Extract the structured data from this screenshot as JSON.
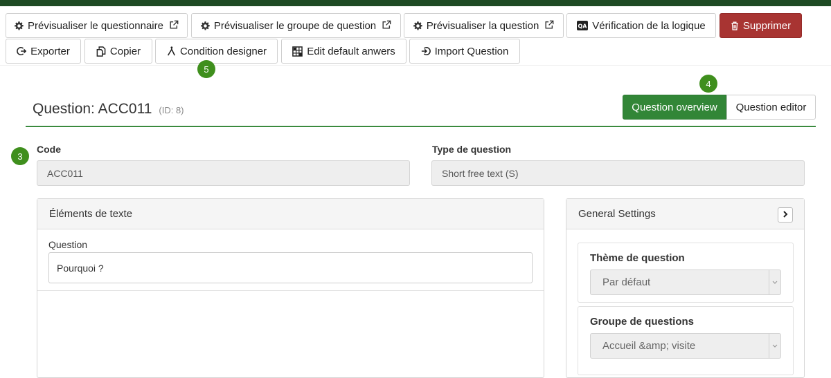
{
  "toolbar": {
    "row1": [
      {
        "label": "Prévisualiser le questionnaire",
        "icon": "gear-icon",
        "external": true
      },
      {
        "label": "Prévisualiser le groupe de question",
        "icon": "gear-icon",
        "external": true
      },
      {
        "label": "Prévisualiser la question",
        "icon": "gear-icon",
        "external": true
      },
      {
        "label": "Vérification de la logique",
        "icon": "qa-icon",
        "external": false
      },
      {
        "label": "Supprimer",
        "icon": "trash-icon",
        "external": false
      }
    ],
    "row2": [
      {
        "label": "Exporter",
        "icon": "export-icon"
      },
      {
        "label": "Copier",
        "icon": "copy-icon"
      },
      {
        "label": "Condition designer",
        "icon": "fork-icon"
      },
      {
        "label": "Edit default anwers",
        "icon": "grid-icon"
      },
      {
        "label": "Import Question",
        "icon": "import-icon"
      }
    ]
  },
  "badges": {
    "b3": "3",
    "b4": "4",
    "b5": "5"
  },
  "header": {
    "title": "Question: ACC011",
    "id_label": "(ID: 8)"
  },
  "view_toggle": {
    "overview": "Question overview",
    "editor": "Question editor"
  },
  "fields": {
    "code_label": "Code",
    "code_value": "ACC011",
    "type_label": "Type de question",
    "type_value": "Short free text (S)"
  },
  "text_panel": {
    "title": "Éléments de texte",
    "question_label": "Question",
    "question_value": "Pourquoi ?"
  },
  "settings_panel": {
    "title": "General Settings",
    "theme_label": "Thème de question",
    "theme_value": "Par défaut",
    "group_label": "Groupe de questions",
    "group_value": "Accueil &amp; visite"
  },
  "colors": {
    "accent_green": "#328637",
    "badge_green": "#3f8f1d",
    "danger": "#a83432",
    "top_bar": "#1e4a23"
  }
}
